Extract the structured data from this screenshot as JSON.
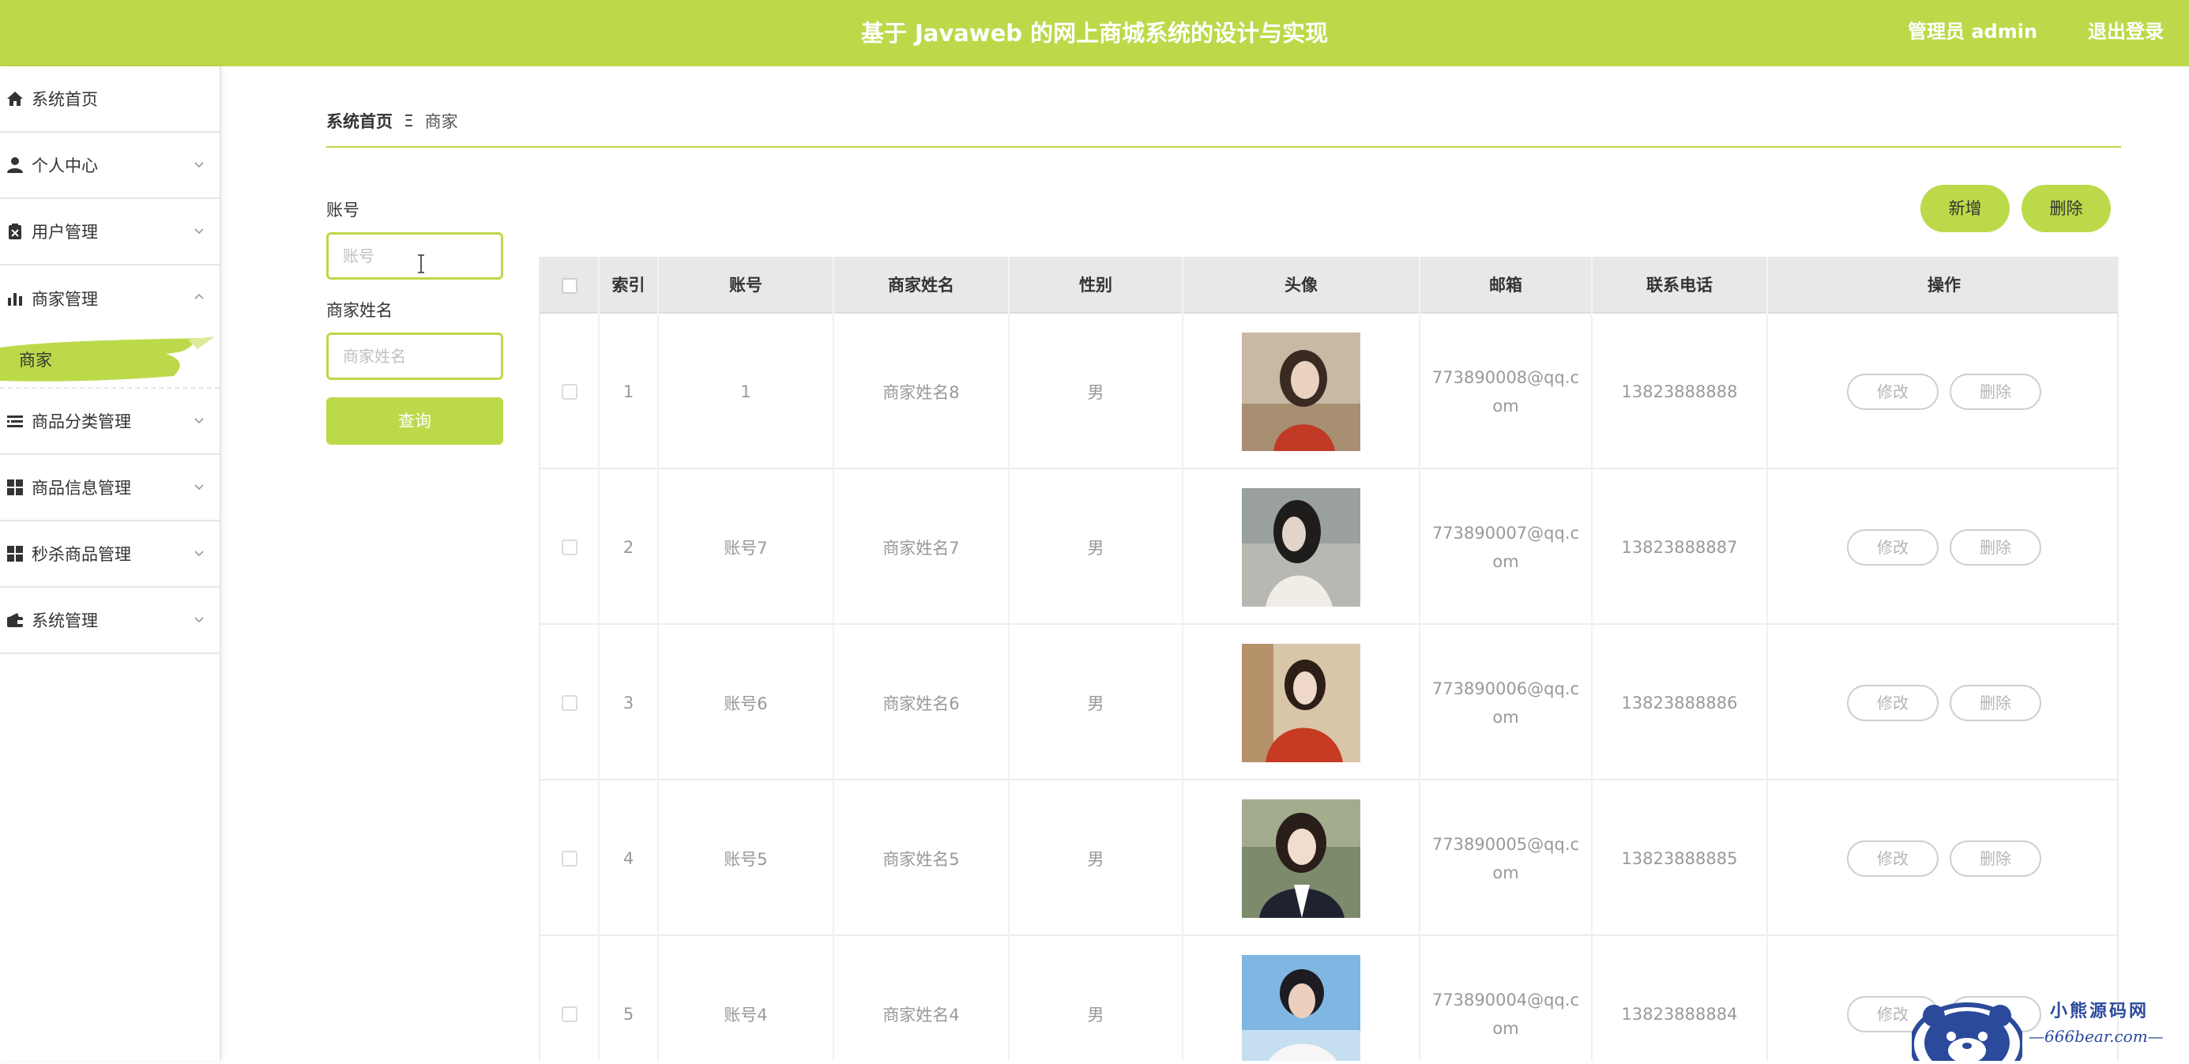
{
  "header": {
    "title": "基于 Javaweb 的网上商城系统的设计与实现",
    "user": "管理员 admin",
    "logout": "退出登录",
    "accent_color": "#bcd94a"
  },
  "sidebar": {
    "items": [
      {
        "label": "系统首页",
        "icon": "home-icon"
      },
      {
        "label": "个人中心",
        "icon": "user-icon"
      },
      {
        "label": "用户管理",
        "icon": "user-manage-icon"
      },
      {
        "label": "商家管理",
        "icon": "bar-chart-icon"
      },
      {
        "label": "商品分类管理",
        "icon": "list-icon"
      },
      {
        "label": "商品信息管理",
        "icon": "grid-icon"
      },
      {
        "label": "秒杀商品管理",
        "icon": "grid-icon"
      },
      {
        "label": "系统管理",
        "icon": "wallet-icon"
      }
    ],
    "active_sub": "商家"
  },
  "breadcrumb": {
    "home": "系统首页",
    "separator": "Ξ",
    "current": "商家"
  },
  "search": {
    "account_label": "账号",
    "account_placeholder": "账号",
    "name_label": "商家姓名",
    "name_placeholder": "商家姓名",
    "query_button": "查询"
  },
  "actions": {
    "add": "新增",
    "delete": "删除"
  },
  "table": {
    "headers": [
      "索引",
      "账号",
      "商家姓名",
      "性别",
      "头像",
      "邮箱",
      "联系电话",
      "操作"
    ],
    "edit_label": "修改",
    "delete_label": "删除",
    "rows": [
      {
        "index": "1",
        "account": "1",
        "name": "商家姓名8",
        "gender": "男",
        "email": "773890008@qq.com",
        "phone": "13823888888"
      },
      {
        "index": "2",
        "account": "账号7",
        "name": "商家姓名7",
        "gender": "男",
        "email": "773890007@qq.com",
        "phone": "13823888887"
      },
      {
        "index": "3",
        "account": "账号6",
        "name": "商家姓名6",
        "gender": "男",
        "email": "773890006@qq.com",
        "phone": "13823888886"
      },
      {
        "index": "4",
        "account": "账号5",
        "name": "商家姓名5",
        "gender": "男",
        "email": "773890005@qq.com",
        "phone": "13823888885"
      },
      {
        "index": "5",
        "account": "账号4",
        "name": "商家姓名4",
        "gender": "男",
        "email": "773890004@qq.com",
        "phone": "13823888884"
      }
    ]
  },
  "watermark": {
    "line1": "小熊源码网",
    "line2": "—666bear.com—"
  }
}
